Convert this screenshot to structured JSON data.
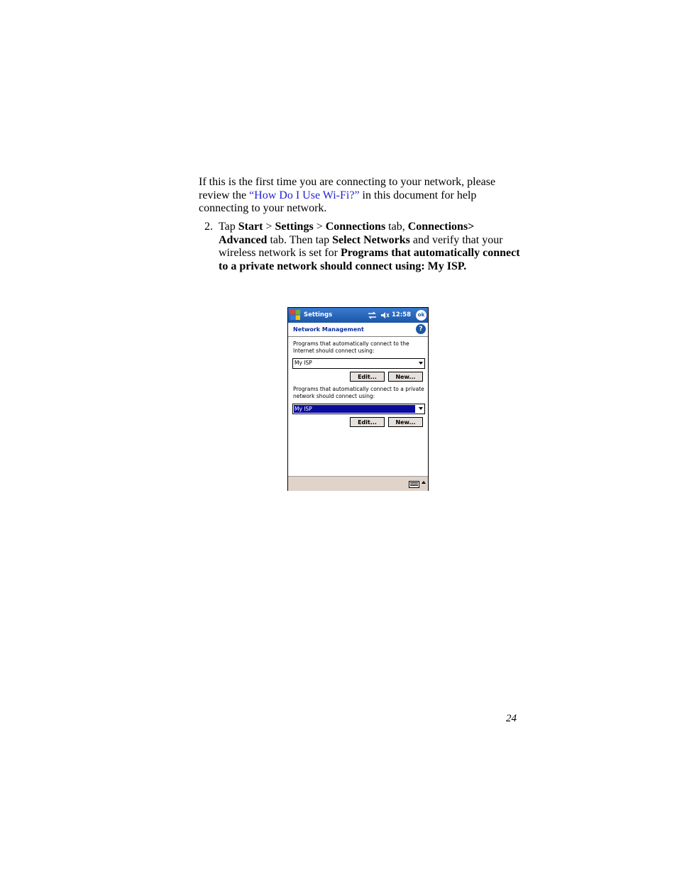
{
  "intro": {
    "part1": "If this is the first time you are connecting to your network, please review the ",
    "link": "“How Do I Use Wi-Fi?”",
    "part2": " in this document for help connecting to your network."
  },
  "step": {
    "number": "2.",
    "t1": "Tap ",
    "b1": "Start",
    "t2": " > ",
    "b2": "Settings",
    "t3": " > ",
    "b3": "Connections",
    "t4": " tab, ",
    "b4": "Connections> Advanced",
    "t5": " tab. Then tap ",
    "b5": "Select Networks",
    "t6": " and verify that your wireless network is set for ",
    "b6": "Programs that automatically connect to a private network should connect using: My ISP."
  },
  "device": {
    "title": "Settings",
    "clock": "12:58",
    "ok_label": "ok",
    "header_title": "Network Management",
    "help_label": "?",
    "internet_label": "Programs that automatically connect to the Internet should connect using:",
    "internet_value": "My ISP",
    "private_label": "Programs that automatically connect to a private network should connect using:",
    "private_value": "My ISP",
    "edit_label": "Edit...",
    "new_label": "New...",
    "icons": [
      "windows-logo-icon",
      "sync-icon",
      "speaker-icon",
      "help-icon",
      "keyboard-icon",
      "up-arrow-icon"
    ]
  },
  "page_number": "24"
}
